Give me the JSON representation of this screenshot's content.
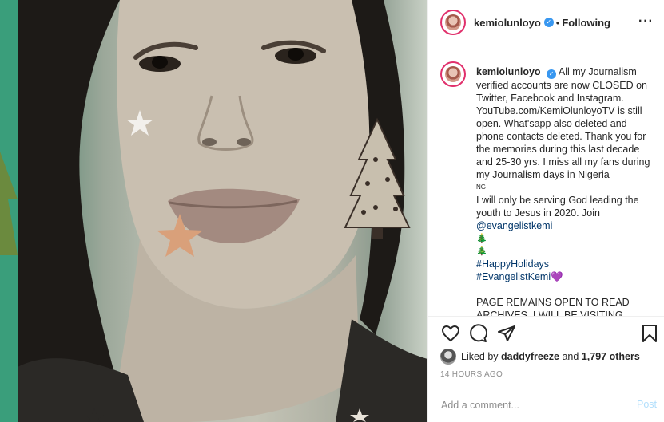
{
  "post": {
    "username": "kemiolunloyo",
    "follow_separator": "•",
    "follow_status": "Following",
    "more_label": "···"
  },
  "caption": {
    "username": "kemiolunloyo",
    "lines": [
      "All my Journalism verified accounts are now CLOSED on Twitter, Facebook and Instagram. YouTube.com/KemiOlunloyoTV is still open. What'sapp also deleted and phone contacts deleted. Thank you for the memories during this last decade and 25-30 yrs. I miss all my fans during my Journalism days in Nigeria",
      "NG",
      "I will only be serving God leading the youth to Jesus in 2020. Join",
      "@evangelistkemi",
      "🎄",
      "🎄",
      "#HappyHolidays",
      "#EvangelistKemi",
      "💜",
      "PAGE REMAINS OPEN TO READ ARCHIVES. I WILL BE VISITING OTHER"
    ]
  },
  "likes": {
    "prefix": "Liked by",
    "liker": "daddyfreeze",
    "and": "and",
    "others": "1,797 others"
  },
  "timestamp": "14 HOURS AGO",
  "comment": {
    "placeholder": "Add a comment...",
    "post_label": "Post"
  },
  "icons": {
    "verified": "verified-badge-icon",
    "like": "heart-icon",
    "comment": "comment-icon",
    "share": "paper-plane-icon",
    "save": "bookmark-icon"
  },
  "colors": {
    "verified": "#3897f0",
    "link": "#003569",
    "muted": "#8e8e8e",
    "post_disabled": "#b2dffc",
    "avatar_ring": "#e1306c"
  }
}
